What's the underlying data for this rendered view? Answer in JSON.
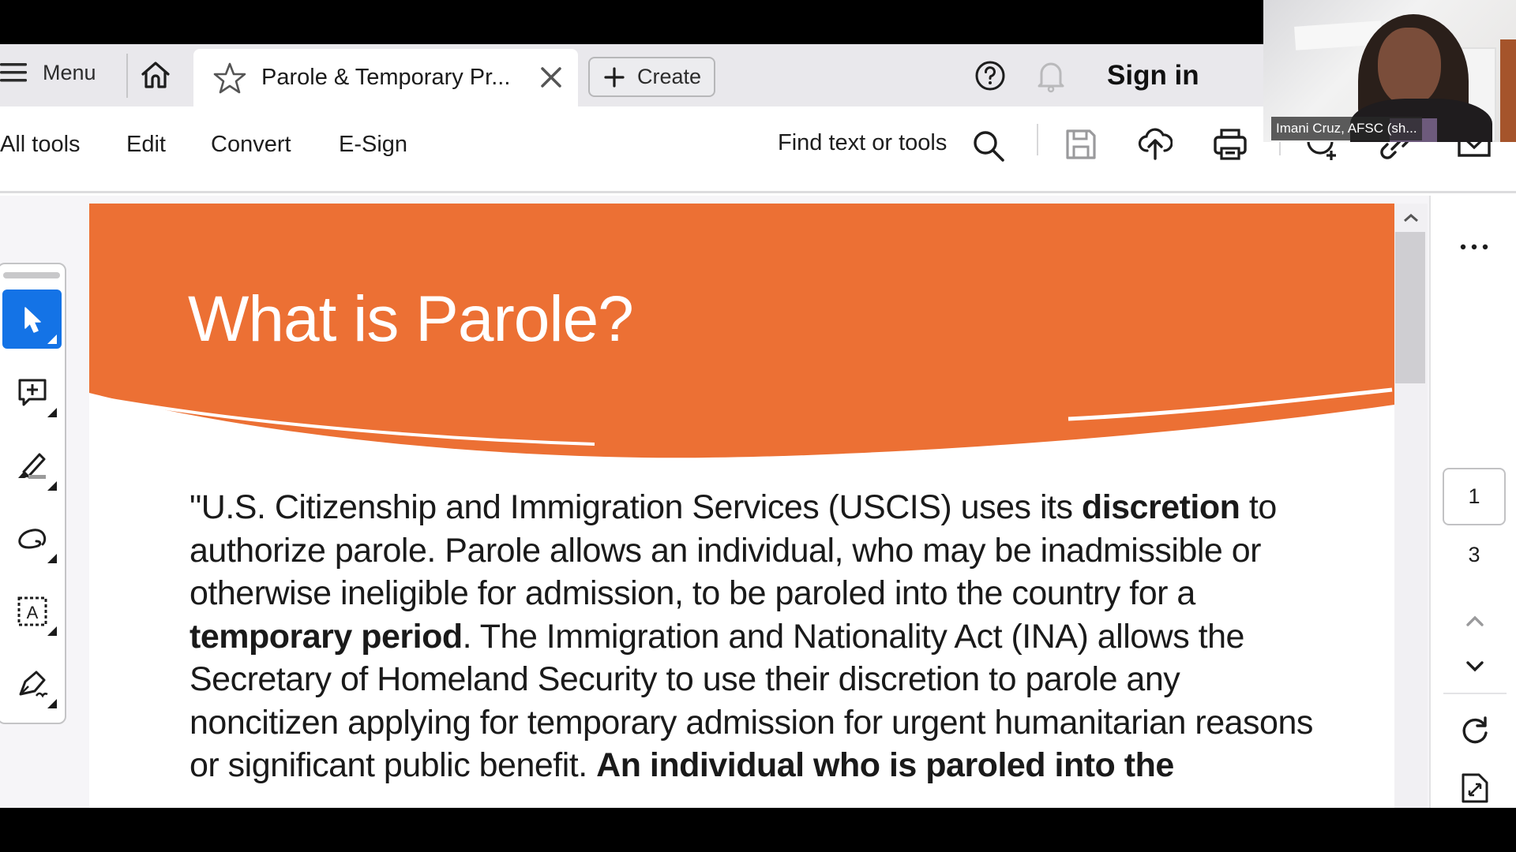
{
  "tabbar": {
    "menu_label": "Menu",
    "active_tab_title": "Parole & Temporary Pr...",
    "create_label": "Create",
    "signin_label": "Sign in"
  },
  "toolbar": {
    "links": [
      "All tools",
      "Edit",
      "Convert",
      "E-Sign"
    ],
    "find_label": "Find text or tools",
    "icons": [
      "save-icon",
      "cloud-upload-icon",
      "print-icon",
      "share-user-icon",
      "link-icon",
      "email-icon"
    ]
  },
  "left_rail": {
    "tools": [
      "select-tool",
      "add-comment-tool",
      "highlight-tool",
      "draw-tool",
      "text-recognition-tool",
      "sign-tool"
    ],
    "active_tool": "select-tool"
  },
  "document": {
    "title": "What is Parole?",
    "header_color": "#ec7034",
    "body_segments": [
      {
        "text": "\"U.S. Citizenship and Immigration Services (USCIS) uses its ",
        "bold": false
      },
      {
        "text": "discretion",
        "bold": true
      },
      {
        "text": " to authorize parole. Parole allows an individual, who may be inadmissible or otherwise ineligible for admission, to be paroled into the country for a ",
        "bold": false
      },
      {
        "text": "temporary period",
        "bold": true
      },
      {
        "text": ". The Immigration and Nationality Act (INA) allows the Secretary of Homeland Security to use their discretion to parole any noncitizen applying for temporary admission for urgent humanitarian reasons or significant public benefit. ",
        "bold": false
      },
      {
        "text": "An individual who is paroled into the",
        "bold": true
      }
    ]
  },
  "right_rail": {
    "current_page": "1",
    "total_pages": "3"
  },
  "webcam": {
    "participant_name": "Imani Cruz, AFSC (sh..."
  },
  "colors": {
    "accent_blue": "#1473e6",
    "doc_orange": "#ec7034"
  }
}
